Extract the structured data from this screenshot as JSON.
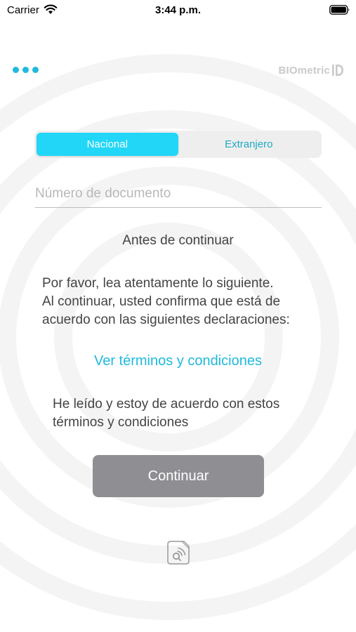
{
  "status_bar": {
    "carrier": "Carrier",
    "time": "3:44 p.m."
  },
  "header": {
    "menu_icon": "more-dots-icon",
    "logo_text": "BIOmetric",
    "logo_mark": "iD",
    "accent_color": "#1fb9df"
  },
  "segmented": {
    "options": [
      {
        "label": "Nacional",
        "selected": true
      },
      {
        "label": "Extranjero",
        "selected": false
      }
    ],
    "active_color": "#22d6f7"
  },
  "document_input": {
    "value": "",
    "placeholder": "Número de documento"
  },
  "content": {
    "heading": "Antes de continuar",
    "body_lines": [
      "Por favor, lea atentamente lo siguiente.",
      "Al continuar, usted confirma que está de",
      "acuerdo con las siguientes declaraciones:"
    ],
    "terms_link": "Ver términos y condiciones",
    "agreement_lines": [
      "He leído y estoy de acuerdo con estos",
      "términos y condiciones"
    ]
  },
  "actions": {
    "continue_label": "Continuar",
    "continue_color": "#8e8e93"
  },
  "footer": {
    "icon": "contactless-card-icon"
  }
}
